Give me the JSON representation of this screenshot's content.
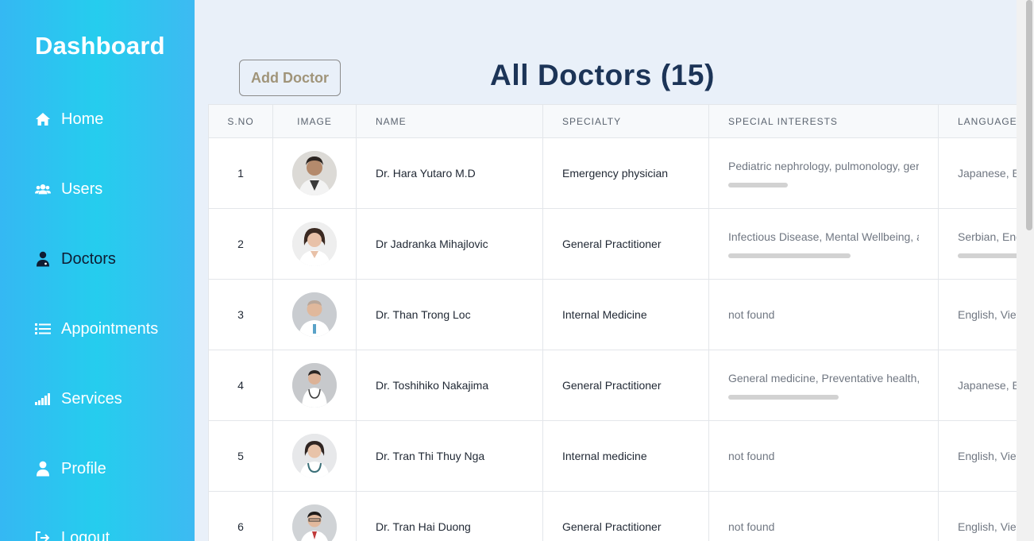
{
  "sidebar": {
    "brand": "Dashboard",
    "items": [
      {
        "label": "Home",
        "icon": "home-icon"
      },
      {
        "label": "Users",
        "icon": "users-icon"
      },
      {
        "label": "Doctors",
        "icon": "doctor-icon",
        "active": true
      },
      {
        "label": "Appointments",
        "icon": "list-icon"
      },
      {
        "label": "Services",
        "icon": "signal-icon"
      },
      {
        "label": "Profile",
        "icon": "user-icon"
      },
      {
        "label": "Logout",
        "icon": "logout-icon"
      }
    ]
  },
  "header": {
    "add_button": "Add Doctor",
    "title": "All Doctors (15)"
  },
  "table": {
    "columns": [
      "S.NO",
      "IMAGE",
      "NAME",
      "SPECIALTY",
      "SPECIAL INTERESTS",
      "LANGUAGE"
    ],
    "rows": [
      {
        "sno": "1",
        "name": "Dr. Hara Yutaro M.D",
        "specialty": "Emergency physician",
        "interests": "Pediatric nephrology, pulmonology, ger",
        "language": "Japanese, E"
      },
      {
        "sno": "2",
        "name": "Dr Jadranka Mihajlovic",
        "specialty": "General Practitioner",
        "interests": "Infectious Disease, Mental Wellbeing, a",
        "language": "Serbian, Eng"
      },
      {
        "sno": "3",
        "name": "Dr. Than Trong Loc",
        "specialty": "Internal Medicine",
        "interests": "not found",
        "language": "English, Viet"
      },
      {
        "sno": "4",
        "name": "Dr. Toshihiko Nakajima",
        "specialty": "General Practitioner",
        "interests": "General medicine, Preventative health,",
        "language": "Japanese, E"
      },
      {
        "sno": "5",
        "name": "Dr. Tran Thi Thuy Nga",
        "specialty": "Internal medicine",
        "interests": "not found",
        "language": "English, Viet"
      },
      {
        "sno": "6",
        "name": "Dr. Tran Hai Duong",
        "specialty": "General Practitioner",
        "interests": "not found",
        "language": "English, Viet"
      }
    ]
  },
  "colors": {
    "sidebar_start": "#35b8f3",
    "sidebar_mid": "#25cdee",
    "title": "#1c3457",
    "button_text": "#a09479",
    "page_bg": "#e9f0f9"
  }
}
